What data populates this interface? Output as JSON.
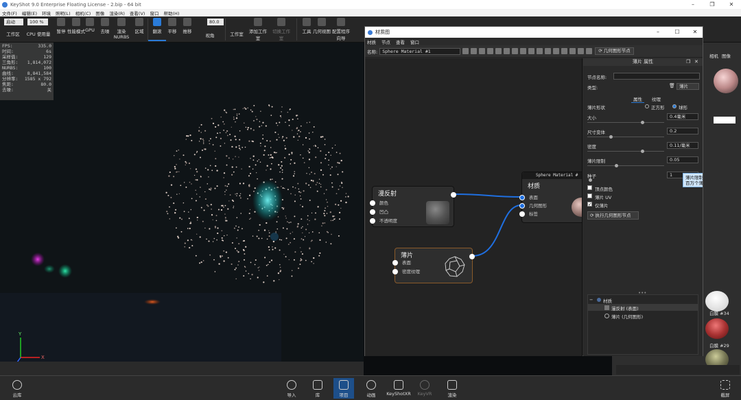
{
  "app": {
    "title": "KeyShot 9.0 Enterprise Floating License  - 2.bip  - 64 bit"
  },
  "menubar": [
    "文件(F)",
    "编辑(E)",
    "环境",
    "照明(L)",
    "相机(C)",
    "图像",
    "渲染(R)",
    "查看(V)",
    "窗口",
    "帮助(H)"
  ],
  "toolbar": {
    "start_box": "启动",
    "percent_box": "100 %",
    "items": [
      "工作区",
      "CPU 使用量",
      "暂停",
      "性能模式",
      "GPU",
      "去噪",
      "渲染NURBS",
      "区域",
      "翻滚",
      "平移",
      "推移",
      "视角",
      "工作室",
      "添加工作室",
      "切换工作室",
      "工具",
      "几何视图",
      "配置程序向导"
    ],
    "fov_box": "80.0"
  },
  "stats": [
    {
      "k": "FPS:",
      "v": "335.0"
    },
    {
      "k": "时间:",
      "v": "6s"
    },
    {
      "k": "采样值:",
      "v": "129"
    },
    {
      "k": "三角形:",
      "v": "1,814,072"
    },
    {
      "k": "NURBS:",
      "v": "100"
    },
    {
      "k": "曲线:",
      "v": "8,841,584"
    },
    {
      "k": "分辨率:",
      "v": "1585 x 792"
    },
    {
      "k": "焦距:",
      "v": "80.0"
    },
    {
      "k": "去噪:",
      "v": "关"
    }
  ],
  "axes": {
    "x": "X",
    "y": "Y"
  },
  "bottombar": [
    {
      "label": "云库"
    },
    {
      "label": "导入"
    },
    {
      "label": "库"
    },
    {
      "label": "项目"
    },
    {
      "label": "动画"
    },
    {
      "label": "KeyShotXR"
    },
    {
      "label": "KeyVR"
    },
    {
      "label": "渲染"
    },
    {
      "label": "截屏"
    }
  ],
  "material_window": {
    "title": "材质图",
    "menu": [
      "材质",
      "节点",
      "查看",
      "窗口"
    ],
    "name_label": "名称:",
    "name_value": "Sphere Material #1",
    "geometry_node_button": "几何图形节点"
  },
  "nodes": {
    "diffuse": {
      "title": "漫反射",
      "ports": [
        "颜色",
        "凹凸",
        "不透明度"
      ]
    },
    "flakes": {
      "title": "薄片",
      "ports": [
        "表面",
        "密度纹理"
      ]
    },
    "material": {
      "header": "Sphere Material #",
      "title": "材质",
      "ports": [
        "表面",
        "几何图形",
        "标签"
      ]
    }
  },
  "properties": {
    "panel_title": "薄片 属性",
    "node_name_label": "节点名称:",
    "node_name_value": "",
    "type_label": "类型:",
    "type_value": "薄片",
    "tabs": [
      "属性",
      "纹理"
    ],
    "flake_shape_label": "薄片形状",
    "shape_square": "正方形",
    "shape_sphere": "球形",
    "size_label": "大小",
    "size_value": "0.4毫米",
    "size_variation_label": "尺寸变体",
    "size_variation_value": "0.2",
    "density_label": "密度",
    "density_value": "0.11/毫米",
    "flake_limit_label": "薄片限制",
    "flake_limit_value": "0.05",
    "seed_label": "种子",
    "seed_value": "1",
    "vertex_color_label": "顶点颜色",
    "flake_uv_label": "薄片 UV",
    "only_flakes_label": "仅薄片",
    "run_button": "执行几何图形节点",
    "tooltip_title": "薄片限制",
    "tooltip_body": "百万个薄片限制。"
  },
  "tree": {
    "root": "材质",
    "children": [
      "漫反射 (表面)",
      "薄片 (几何图形)"
    ]
  },
  "right_panel": {
    "tabs": [
      "相机",
      "图像"
    ],
    "swatch_labels": [
      "白膜 #34",
      "白膜 #29"
    ]
  },
  "colors": {
    "accent": "#2a7bd8",
    "node_bg": "#2e2e2e",
    "wire": "#1f6fe0",
    "flakes_border": "#8a5a2a"
  }
}
